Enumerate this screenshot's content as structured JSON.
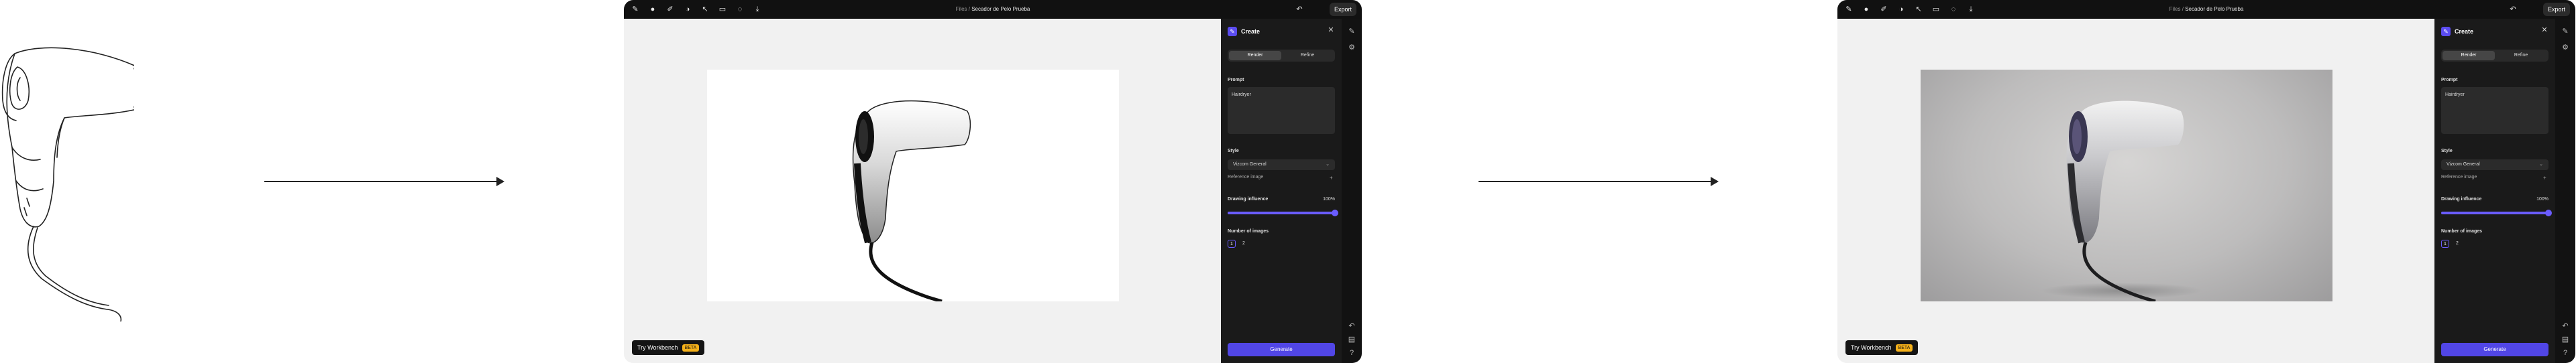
{
  "breadcrumb": {
    "folder": "Files",
    "separator": " / ",
    "document": "Secador de Pelo Prueba"
  },
  "toolbar": {
    "export_label": "Export"
  },
  "panel": {
    "title": "Create",
    "tabs": [
      {
        "label": "Render",
        "active": true
      },
      {
        "label": "Refine",
        "active": false
      }
    ],
    "prompt_label": "Prompt",
    "prompt_value": "Hairdryer",
    "style_label": "Style",
    "style_value": "Vizcom General",
    "reference_label": "Reference image",
    "influence_label": "Drawing influence",
    "influence_value": "100%",
    "influence_fraction": 1.0,
    "num_images_label": "Number of images",
    "num_images_options": [
      "1",
      "2"
    ],
    "num_images_selected": "1",
    "generate_label": "Generate"
  },
  "workbench": {
    "label": "Try Workbench",
    "badge": "BETA"
  },
  "colors": {
    "accent": "#5146e6",
    "topbar": "#111111",
    "panel": "#1a1a1a",
    "canvas": "#f1f1f1"
  },
  "icons": [
    "logo-icon",
    "circle-tool-icon",
    "brush-icon",
    "palette-icon",
    "select-icon",
    "shape-icon",
    "lasso-icon",
    "download-icon",
    "undo-icon",
    "generate-icon",
    "settings-icon"
  ]
}
